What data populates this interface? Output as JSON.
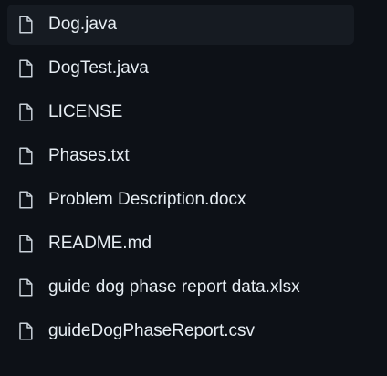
{
  "file_list": {
    "items": [
      {
        "name": "Dog.java",
        "icon": "file-icon",
        "selected": true
      },
      {
        "name": "DogTest.java",
        "icon": "file-icon",
        "selected": false
      },
      {
        "name": "LICENSE",
        "icon": "file-icon",
        "selected": false
      },
      {
        "name": "Phases.txt",
        "icon": "file-icon",
        "selected": false
      },
      {
        "name": "Problem Description.docx",
        "icon": "file-icon",
        "selected": false
      },
      {
        "name": "README.md",
        "icon": "file-icon",
        "selected": false
      },
      {
        "name": "guide dog phase report data.xlsx",
        "icon": "file-icon",
        "selected": false
      },
      {
        "name": "guideDogPhaseReport.csv",
        "icon": "file-icon",
        "selected": false
      }
    ]
  },
  "colors": {
    "background": "#0d1117",
    "selected_row": "#161b22",
    "text": "#e6edf3",
    "icon": "#c9d1d9"
  }
}
